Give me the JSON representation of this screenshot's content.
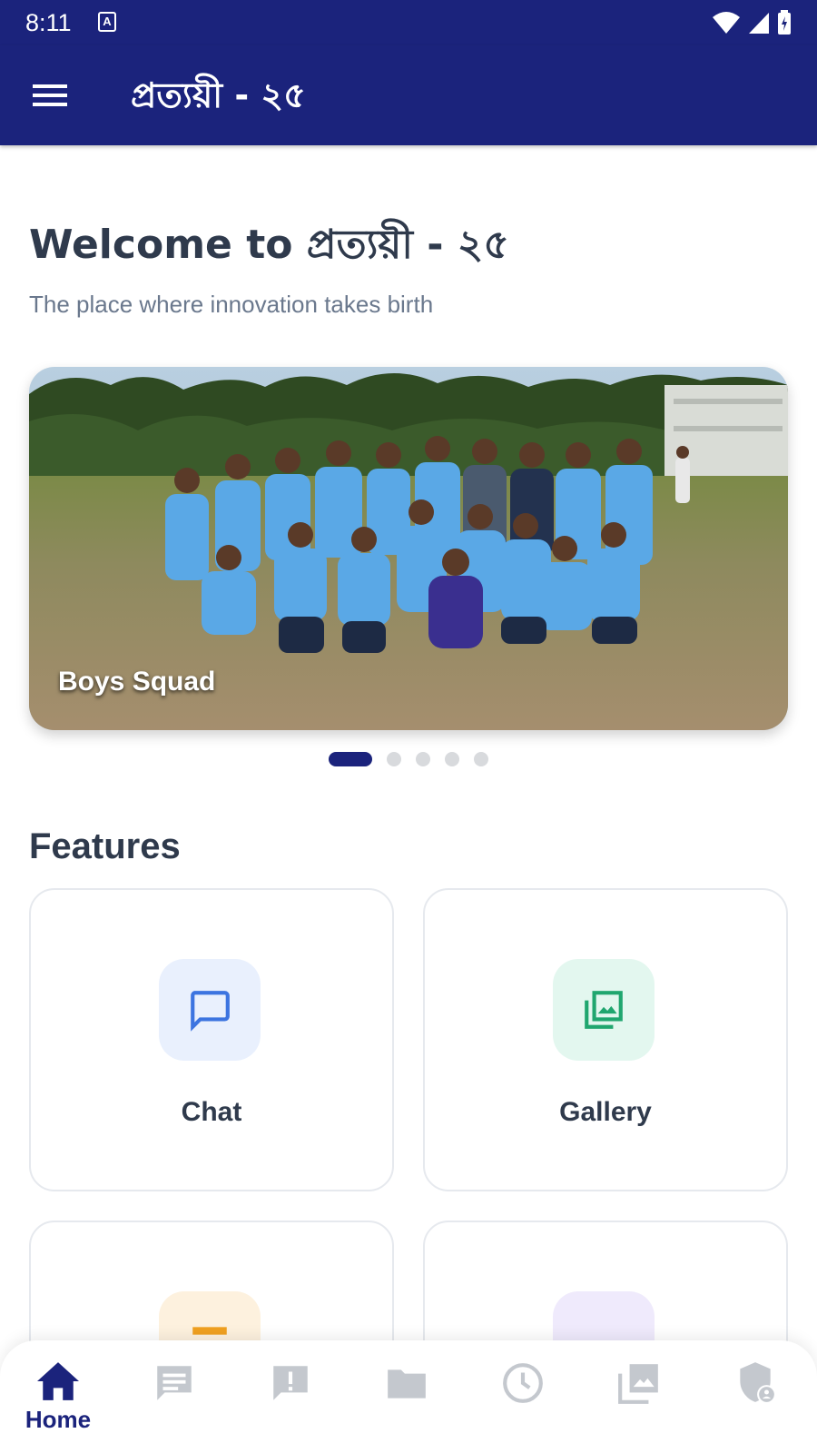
{
  "status_bar": {
    "time": "8:11",
    "notification_icon": "A"
  },
  "app_bar": {
    "title": "প্রত্যয়ী - ২৫"
  },
  "hero": {
    "welcome": "Welcome to প্রত্যয়ী - ২৫",
    "tagline": "The place where innovation takes birth"
  },
  "carousel": {
    "caption": "Boys Squad",
    "slide_count": 5,
    "active_index": 0
  },
  "features": {
    "title": "Features",
    "cards": [
      {
        "label": "Chat",
        "icon": "chat-bubble-icon",
        "tile_color": "#e9f0fd",
        "icon_color": "#3c74e0"
      },
      {
        "label": "Gallery",
        "icon": "gallery-icon",
        "tile_color": "#e3f7ef",
        "icon_color": "#20a66f"
      },
      {
        "label": "",
        "icon": "notice-icon",
        "tile_color": "#fdf1de",
        "icon_color": "#f0a020"
      },
      {
        "label": "",
        "icon": "unknown-icon",
        "tile_color": "#efeafc",
        "icon_color": "#7b5be0"
      }
    ]
  },
  "bottom_nav": {
    "items": [
      {
        "label": "Home",
        "icon": "home-icon",
        "active": true
      },
      {
        "label": "",
        "icon": "message-icon",
        "active": false
      },
      {
        "label": "",
        "icon": "feedback-icon",
        "active": false
      },
      {
        "label": "",
        "icon": "folder-icon",
        "active": false
      },
      {
        "label": "",
        "icon": "clock-icon",
        "active": false
      },
      {
        "label": "",
        "icon": "photos-icon",
        "active": false
      },
      {
        "label": "",
        "icon": "admin-shield-icon",
        "active": false
      }
    ],
    "active_color": "#1b237c",
    "inactive_color": "#c4c8ce"
  }
}
